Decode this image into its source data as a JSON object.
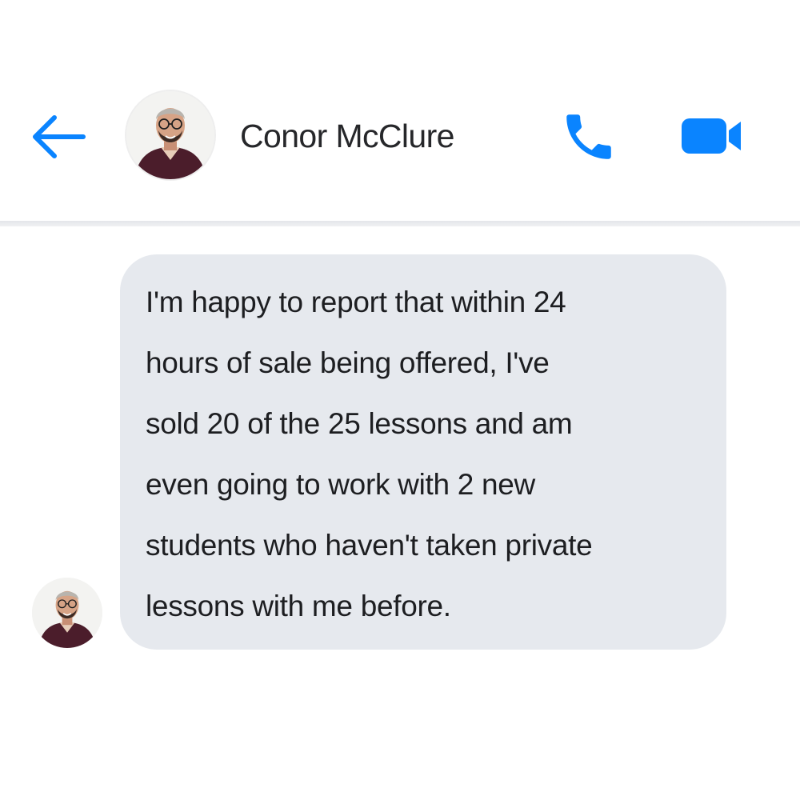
{
  "conversation": {
    "contact_name": "Conor McClure",
    "accent_color": "#0a84ff",
    "bubble_color": "#e6e9ee",
    "message": {
      "lines": [
        "I'm happy to report that within 24",
        "hours of sale being offered, I've",
        "sold 20 of the 25 lessons and am",
        "even going to work with 2 new",
        "students who haven't taken private",
        "lessons with me before."
      ]
    }
  },
  "icons": {
    "back": "back-arrow-icon",
    "call": "phone-icon",
    "video": "video-camera-icon",
    "avatar": "contact-avatar"
  }
}
